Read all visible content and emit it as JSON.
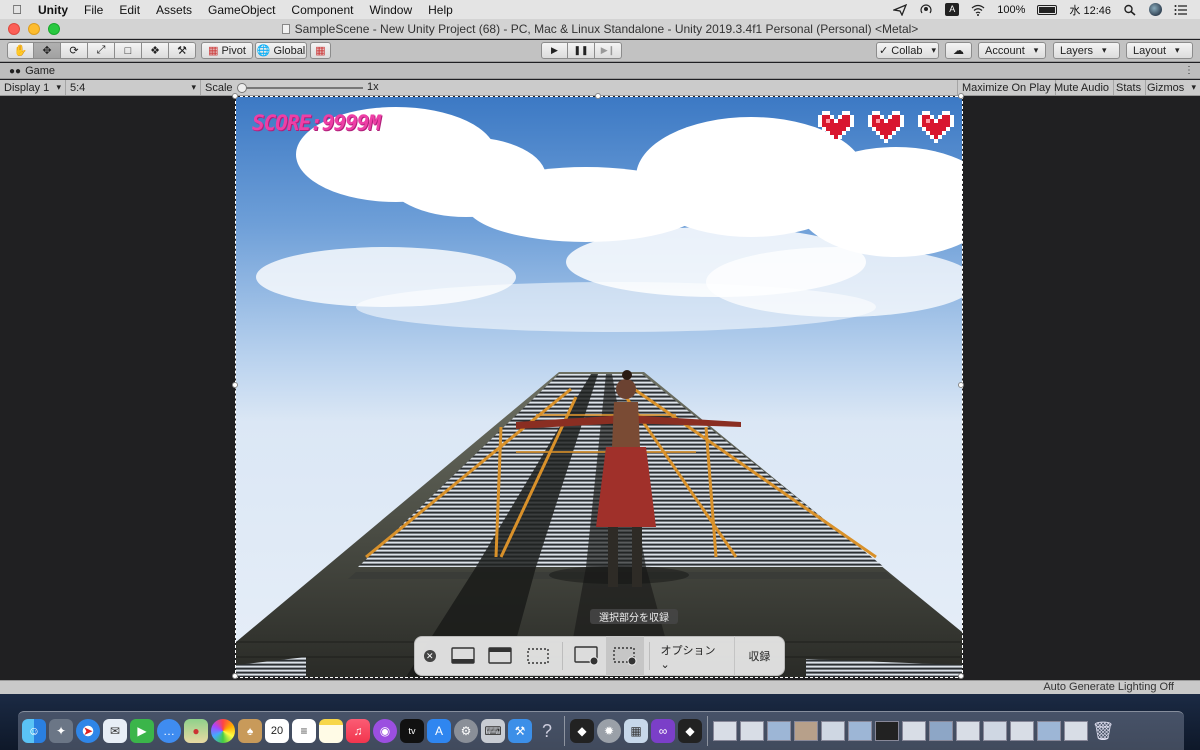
{
  "menubar": {
    "app": "Unity",
    "items": [
      "File",
      "Edit",
      "Assets",
      "GameObject",
      "Component",
      "Window",
      "Help"
    ],
    "battery": "100%",
    "clock": "水 12:46"
  },
  "window": {
    "title": "SampleScene - New Unity Project (68) - PC, Mac & Linux Standalone - Unity 2019.3.4f1 Personal (Personal) <Metal>"
  },
  "toolbar": {
    "pivot_label": "Pivot",
    "global_label": "Global",
    "collab_label": "Collab",
    "account_label": "Account",
    "layers_label": "Layers",
    "layout_label": "Layout"
  },
  "game_tab": {
    "label": "Game"
  },
  "game_bar": {
    "display": "Display 1",
    "aspect": "5:4",
    "scale_label": "Scale",
    "scale_value": "1x",
    "maximize": "Maximize On Play",
    "mute": "Mute Audio",
    "stats": "Stats",
    "gizmos": "Gizmos"
  },
  "hud": {
    "score": "SCORE:9999M",
    "hearts": 3,
    "heart_color": "#d8172f"
  },
  "capture": {
    "tooltip": "選択部分を収録",
    "options": "オプション",
    "record": "収録"
  },
  "statusbar": {
    "text": "Auto Generate Lighting Off"
  }
}
